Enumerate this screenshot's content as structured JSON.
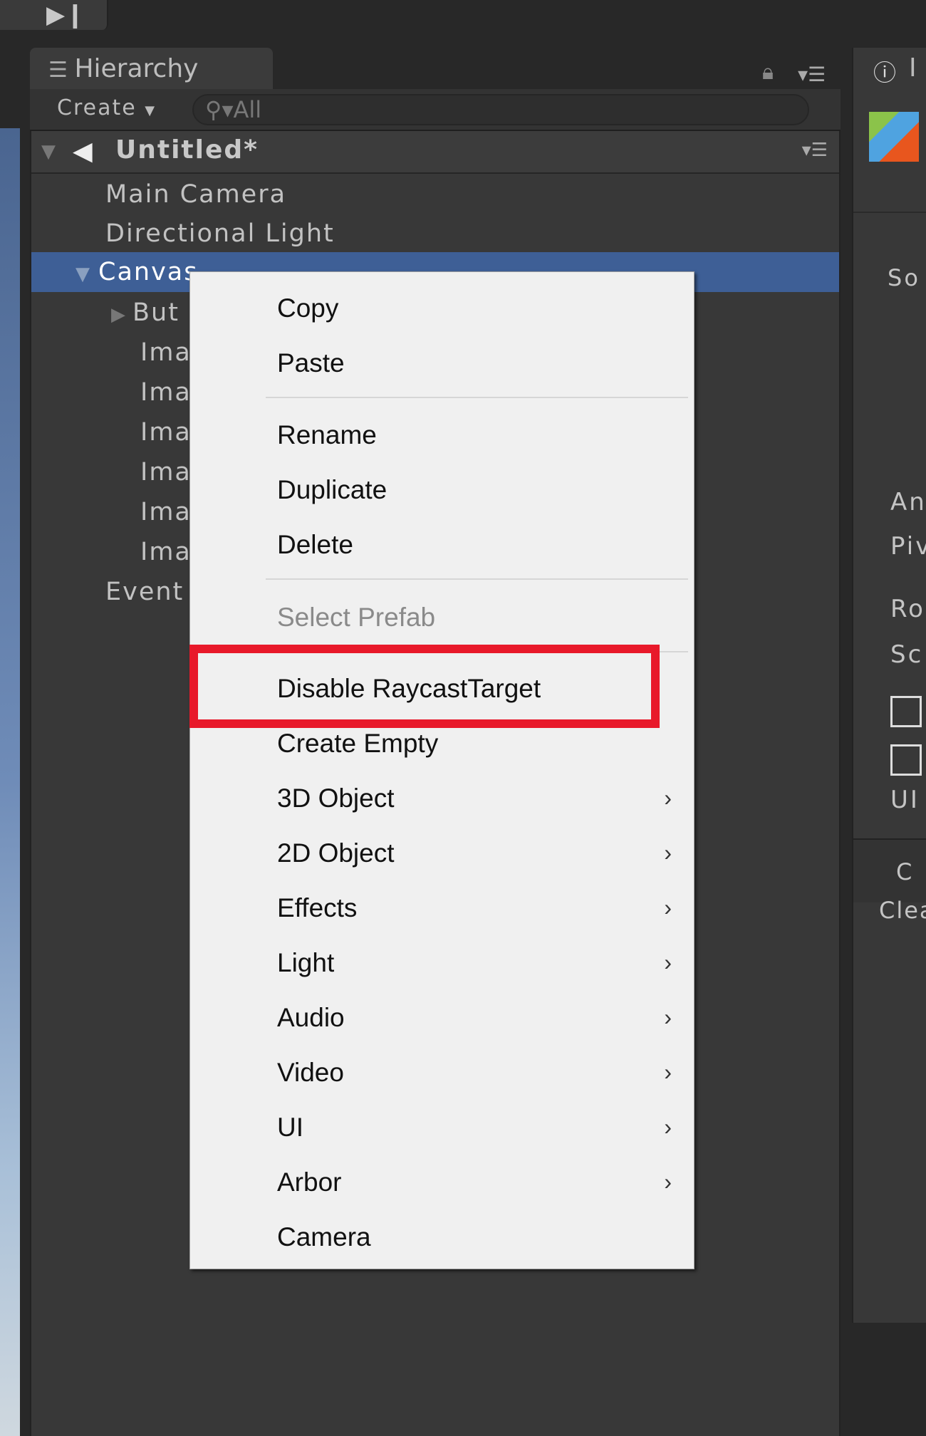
{
  "hierarchy": {
    "tab_label": "Hierarchy",
    "create_label": "Create",
    "search_placeholder": "All",
    "scene_name": "Untitled*",
    "items": [
      "Main Camera",
      "Directional Light",
      "Canvas",
      "But",
      "Ima",
      "Ima",
      "Ima",
      "Ima",
      "Ima",
      "Ima",
      "Event"
    ]
  },
  "inspector": {
    "tab_label": "I",
    "labels": [
      "So",
      "An",
      "Piv",
      "Ro",
      "Sc",
      "UI"
    ],
    "console_tab": "C",
    "console_clear": "Clea"
  },
  "context_menu": {
    "items": [
      {
        "label": "Copy"
      },
      {
        "label": "Paste"
      },
      {
        "label": "Rename"
      },
      {
        "label": "Duplicate"
      },
      {
        "label": "Delete"
      },
      {
        "label": "Select Prefab",
        "disabled": true
      },
      {
        "label": "Disable RaycastTarget",
        "highlighted": true
      },
      {
        "label": "Create Empty"
      },
      {
        "label": "3D Object",
        "submenu": true
      },
      {
        "label": "2D Object",
        "submenu": true
      },
      {
        "label": "Effects",
        "submenu": true
      },
      {
        "label": "Light",
        "submenu": true
      },
      {
        "label": "Audio",
        "submenu": true
      },
      {
        "label": "Video",
        "submenu": true
      },
      {
        "label": "UI",
        "submenu": true
      },
      {
        "label": "Arbor",
        "submenu": true
      },
      {
        "label": "Camera"
      }
    ]
  },
  "colors": {
    "selection": "#3e5f96",
    "highlight_box": "#e8192a"
  }
}
